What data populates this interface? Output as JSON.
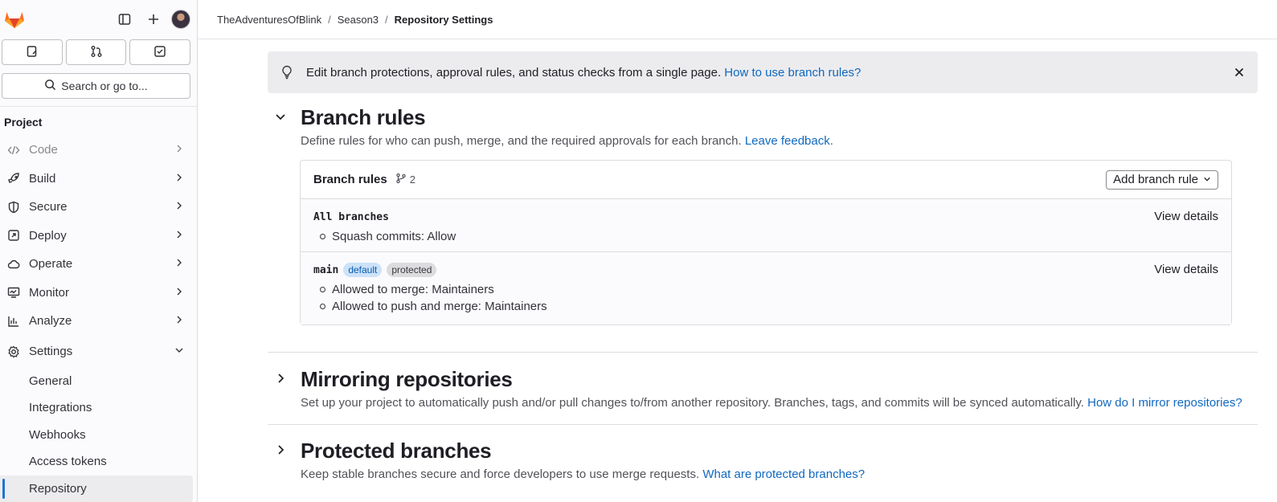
{
  "sidebar": {
    "counts": [
      {
        "icon": "issues-icon"
      },
      {
        "icon": "merge-request-icon"
      },
      {
        "icon": "todo-icon"
      }
    ],
    "search_label": "Search or go to...",
    "section_label": "Project",
    "nav": [
      {
        "label": "Code",
        "icon": "code-icon",
        "muted": true
      },
      {
        "label": "Build",
        "icon": "rocket-icon"
      },
      {
        "label": "Secure",
        "icon": "shield-icon"
      },
      {
        "label": "Deploy",
        "icon": "deploy-icon"
      },
      {
        "label": "Operate",
        "icon": "cloud-icon"
      },
      {
        "label": "Monitor",
        "icon": "monitor-icon"
      },
      {
        "label": "Analyze",
        "icon": "chart-icon"
      }
    ],
    "settings_label": "Settings",
    "settings_items": [
      "General",
      "Integrations",
      "Webhooks",
      "Access tokens",
      "Repository"
    ],
    "active_settings_item": "Repository"
  },
  "breadcrumb": {
    "items": [
      "TheAdventuresOfBlink",
      "Season3",
      "Repository Settings"
    ]
  },
  "alert": {
    "text": "Edit branch protections, approval rules, and status checks from a single page.",
    "link": "How to use branch rules?"
  },
  "branch_rules": {
    "title": "Branch rules",
    "description": "Define rules for who can push, merge, and the required approvals for each branch.",
    "link": "Leave feedback.",
    "card_title": "Branch rules",
    "count": "2",
    "add_button": "Add branch rule",
    "rules": [
      {
        "name": "All branches",
        "badges": [],
        "items": [
          "Squash commits: Allow"
        ],
        "action": "View details"
      },
      {
        "name": "main",
        "badges": [
          "default",
          "protected"
        ],
        "items": [
          "Allowed to merge: Maintainers",
          "Allowed to push and merge: Maintainers"
        ],
        "action": "View details"
      }
    ]
  },
  "mirroring": {
    "title": "Mirroring repositories",
    "description": "Set up your project to automatically push and/or pull changes to/from another repository. Branches, tags, and commits will be synced automatically.",
    "link": "How do I mirror repositories?"
  },
  "protected": {
    "title": "Protected branches",
    "description": "Keep stable branches secure and force developers to use merge requests.",
    "link": "What are protected branches?"
  },
  "colors": {
    "link": "#1068bf",
    "accent": "#1f75cb",
    "badge_default_bg": "#cbe2f9"
  }
}
